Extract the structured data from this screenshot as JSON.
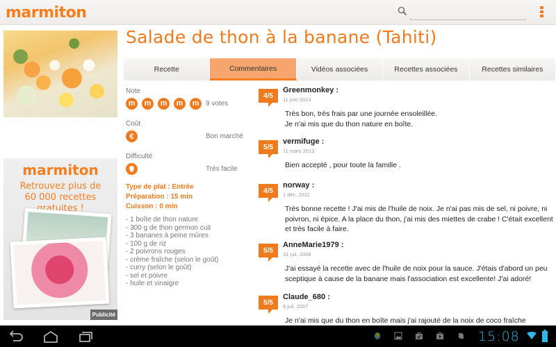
{
  "actionbar": {
    "logo": "marmiton",
    "search_placeholder": "",
    "icons": [
      "search-icon",
      "overflow-menu-icon"
    ]
  },
  "recipe": {
    "title": "Salade de thon à la banane (Tahiti)",
    "tabs": [
      {
        "label": "Recette",
        "active": false
      },
      {
        "label": "Commentaires",
        "active": true
      },
      {
        "label": "Vidéos associées",
        "active": false
      },
      {
        "label": "Recettes associées",
        "active": false
      },
      {
        "label": "Recettes similaires",
        "active": false
      }
    ],
    "note_label": "Note",
    "note_icon_glyph": "m",
    "rating_icons_count": 5,
    "votes": "9 votes",
    "cost_label": "Coût",
    "cost_icon_glyph": "€",
    "cost_value": "Bon marché",
    "difficulty_label": "Difficulté",
    "difficulty_value": "Très facile",
    "type_de_plat": "Type de plat : Entrée",
    "preparation": "Préparation : 15 min",
    "cuisson": "Cuisson : 0 min",
    "ingredients": [
      "- 1 boîte de thon nature",
      "- 300 g de thon germon cuit",
      "- 3 bananes à peine mûres",
      "- 100 g de riz",
      "- 2 poivrons rouges",
      "- crème fraîche (selon le goût)",
      "- curry (selon le goût)",
      "- sel et poivre",
      "- huile et vinaigre"
    ]
  },
  "ad": {
    "logo": "marmiton",
    "line1": "Retrouvez plus de",
    "line2": "60 000 recettes gratuites !",
    "badge": "Publicité"
  },
  "comments": [
    {
      "rating": "4/5",
      "author": "Greenmonkey :",
      "date": "11 juin 2013",
      "text": "Très bon, très frais par une journée ensoleillée.\nJe n'ai mis que du thon nature en boîte."
    },
    {
      "rating": "5/5",
      "author": "vermifuge :",
      "date": "11 mars 2013",
      "text": "Bien accepté , pour toute la famille ."
    },
    {
      "rating": "4/5",
      "author": "norway :",
      "date": "1 déc. 2011",
      "text": "Très bonne recette ! J'ai mis de l'huile de noix. Je n'ai pas mis de sel, ni poivre, ni poivron, ni épice. A la place du thon, j'ai mis des miettes de crabe ! C'était excellent et très facile à faire."
    },
    {
      "rating": "5/5",
      "author": "AnneMarie1979 :",
      "date": "31 juil. 2008",
      "text": "J'ai essayé la recette avec de l'huile de noix pour la sauce. J'étais d'abord un peu sceptique à cause de la banane mais l'association est excellente! J'ai adoré!"
    },
    {
      "rating": "5/5",
      "author": "Claude_680 :",
      "date": "8 juil. 2007",
      "text": "Je n'ai mis que du thon en boîte mais j'ai rajouté de la noix de coco fraîche"
    }
  ],
  "systembar": {
    "time": "15:08",
    "nav": [
      "back-icon",
      "home-icon",
      "recent-apps-icon"
    ],
    "notifications": [
      "android-debug-icon",
      "gallery-icon",
      "store-download-icon",
      "play-store-icon",
      "evernote-icon"
    ],
    "status": [
      "wifi-icon",
      "battery-icon"
    ],
    "accent": "#33b5e5"
  },
  "colors": {
    "brand": "#f57f20",
    "tab_active": "#f5a56d"
  }
}
